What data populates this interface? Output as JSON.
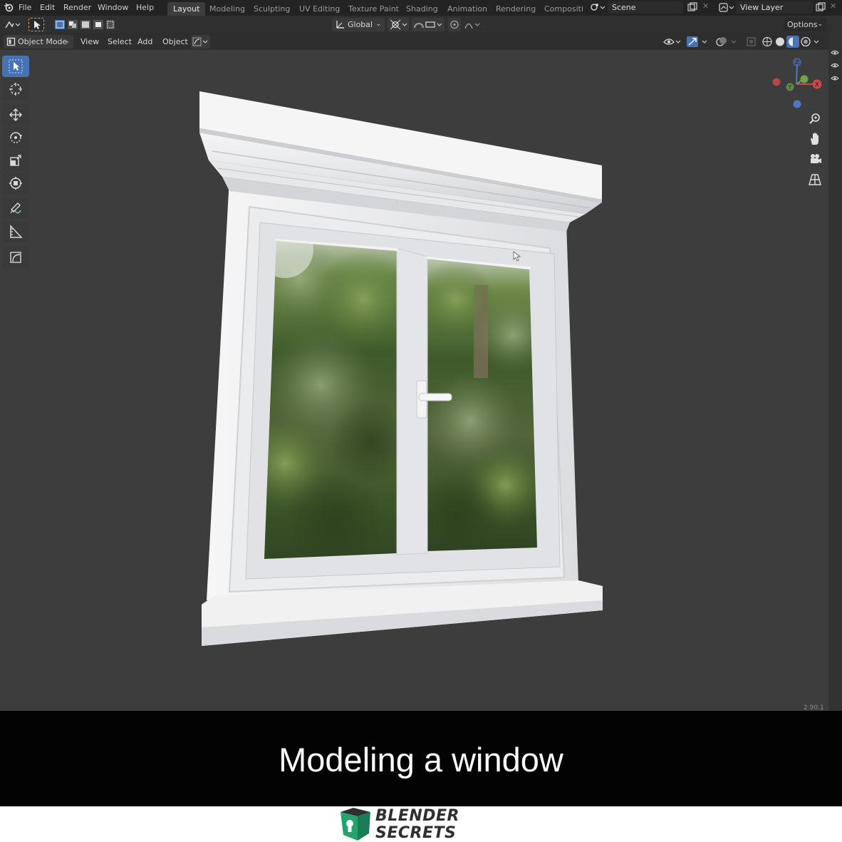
{
  "menu": {
    "items": [
      "File",
      "Edit",
      "Render",
      "Window",
      "Help"
    ]
  },
  "workspaces": {
    "tabs": [
      "Layout",
      "Modeling",
      "Sculpting",
      "UV Editing",
      "Texture Paint",
      "Shading",
      "Animation",
      "Rendering",
      "Compositi"
    ],
    "active": "Layout"
  },
  "scene": {
    "label": "Scene"
  },
  "view_layer": {
    "label": "View Layer"
  },
  "tool_header": {
    "transform_orientation": "Global",
    "options_label": "Options"
  },
  "view_header": {
    "mode": "Object Mode",
    "menus": [
      "View",
      "Select",
      "Add",
      "Object"
    ]
  },
  "viewport": {
    "version": "2.90.1",
    "background_color": "#3d3d3d",
    "gizmo_axes": [
      "X",
      "Y",
      "Z"
    ]
  },
  "caption": {
    "title": "Modeling a window"
  },
  "brand": {
    "line1": "BLENDER",
    "line2": "SECRETS",
    "color": "#2f2f2f",
    "accent": "#25a36f"
  }
}
